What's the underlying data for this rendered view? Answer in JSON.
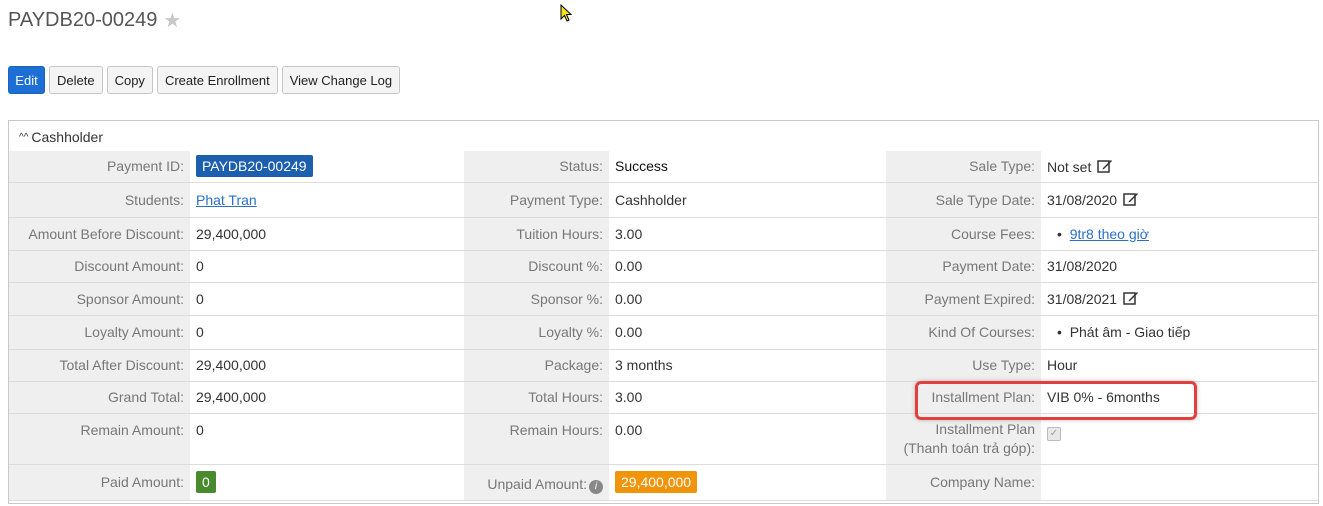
{
  "title": "PAYDB20-00249",
  "toolbar": {
    "edit": "Edit",
    "delete": "Delete",
    "copy": "Copy",
    "create_enrollment": "Create Enrollment",
    "view_change_log": "View Change Log"
  },
  "panel": {
    "heading": "Cashholder"
  },
  "col1": {
    "payment_id_label": "Payment ID:",
    "payment_id": "PAYDB20-00249",
    "students_label": "Students:",
    "students": "Phat Tran",
    "amount_before_label": "Amount Before Discount:",
    "amount_before": "29,400,000",
    "discount_amount_label": "Discount Amount:",
    "discount_amount": "0",
    "sponsor_amount_label": "Sponsor Amount:",
    "sponsor_amount": "0",
    "loyalty_amount_label": "Loyalty Amount:",
    "loyalty_amount": "0",
    "total_after_label": "Total After Discount:",
    "total_after": "29,400,000",
    "grand_total_label": "Grand Total:",
    "grand_total": "29,400,000",
    "remain_amount_label": "Remain Amount:",
    "remain_amount": "0",
    "paid_amount_label": "Paid Amount:",
    "paid_amount": "0"
  },
  "col2": {
    "status_label": "Status:",
    "status": "Success",
    "payment_type_label": "Payment Type:",
    "payment_type": "Cashholder",
    "tuition_hours_label": "Tuition Hours:",
    "tuition_hours": "3.00",
    "discount_pct_label": "Discount %:",
    "discount_pct": "0.00",
    "sponsor_pct_label": "Sponsor %:",
    "sponsor_pct": "0.00",
    "loyalty_pct_label": "Loyalty %:",
    "loyalty_pct": "0.00",
    "package_label": "Package:",
    "package": "3 months",
    "total_hours_label": "Total Hours:",
    "total_hours": "3.00",
    "remain_hours_label": "Remain Hours:",
    "remain_hours": "0.00",
    "unpaid_amount_label": "Unpaid Amount:",
    "unpaid_amount": "29,400,000"
  },
  "col3": {
    "sale_type_label": "Sale Type:",
    "sale_type": "Not set",
    "sale_type_date_label": "Sale Type Date:",
    "sale_type_date": "31/08/2020",
    "course_fees_label": "Course Fees:",
    "course_fees": "9tr8 theo giờ",
    "payment_date_label": "Payment Date:",
    "payment_date": "31/08/2020",
    "payment_expired_label": "Payment Expired:",
    "payment_expired": "31/08/2021",
    "kind_of_courses_label": "Kind Of Courses:",
    "kind_of_courses": "Phát âm - Giao tiếp",
    "use_type_label": "Use Type:",
    "use_type": "Hour",
    "installment_plan_label": "Installment Plan:",
    "installment_plan": "VIB 0% - 6months",
    "installment_plan_check_label_1": "Installment Plan",
    "installment_plan_check_label_2": "(Thanh toán trả góp):",
    "company_name_label": "Company Name:",
    "company_name": ""
  },
  "icons": {
    "star": "star-icon",
    "edit": "edit-icon",
    "info": "info-icon",
    "chevron": "chevron-up-icon"
  },
  "colors": {
    "primary": "#1d6fd6",
    "badge_blue": "#1b5fae",
    "badge_green": "#4a8a2f",
    "badge_orange": "#f0940a",
    "highlight": "#e2403c"
  }
}
